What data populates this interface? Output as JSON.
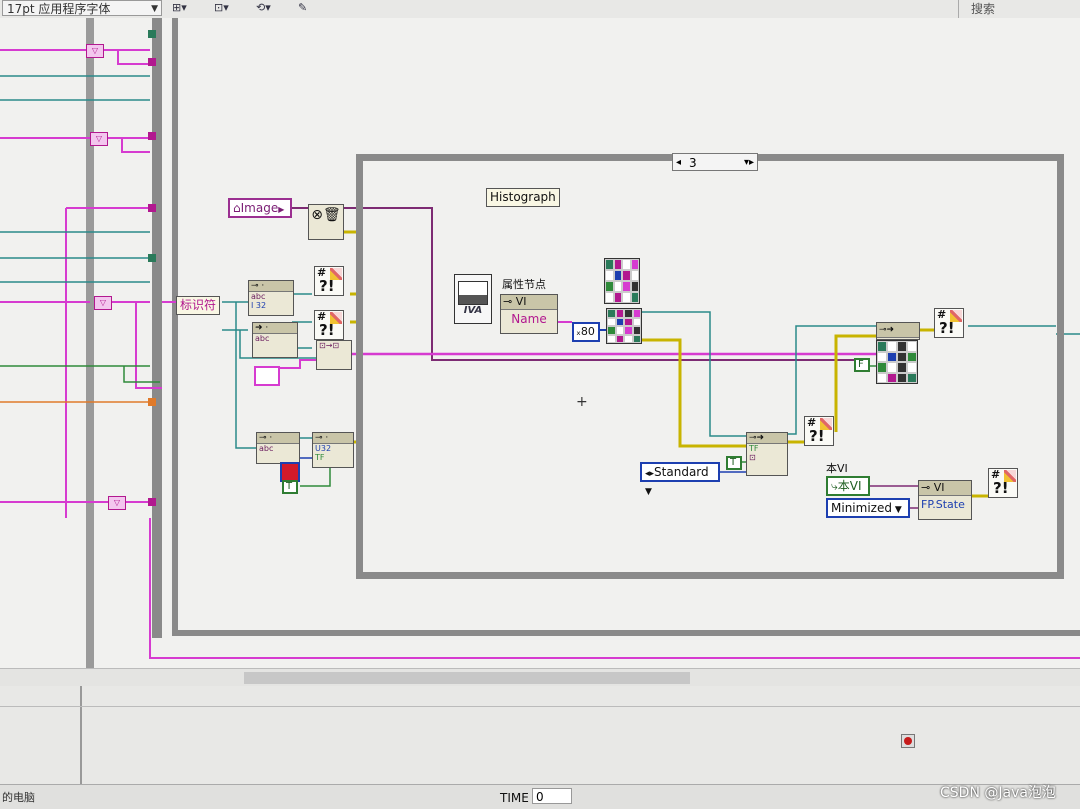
{
  "toolbar": {
    "font_selector": "17pt 应用程序字体",
    "align_icon": "align-objects-icon",
    "distribute_icon": "distribute-objects-icon",
    "reorder_icon": "reorder-icon",
    "cleanup_icon": "cleanup-diagram-icon",
    "search_label": "搜索"
  },
  "diagram": {
    "image_ref_label": "Image",
    "identifier_label": "标识符",
    "histograph_label": "Histograph",
    "property_node_label": "属性节点",
    "property_node_class": "VI",
    "property_node_property": "Name",
    "numeric_const": "80",
    "case_selector_value": "3",
    "standard_enum": "Standard",
    "this_vi_caption": "本VI",
    "this_vi_ref": "本VI",
    "minimized_enum": "Minimized",
    "fp_state_property": "FP.State",
    "fp_state_class": "VI",
    "true_const_1": "T",
    "true_const_2": "T",
    "f_const": "F",
    "node_abc": "abc",
    "node_i32": "I 32",
    "node_u32": "U32",
    "node_tf": "TF",
    "node_tf2": "TF"
  },
  "statusbar": {
    "left_text": "的电脑",
    "time_label": "TIME",
    "time_value": "0",
    "watermark": "CSDN @Java泡泡"
  },
  "colors": {
    "string_wire": "#d63bd0",
    "ref_wire": "#7d2b73",
    "error_wire": "#c8b400",
    "int_wire": "#2a5bd1",
    "bool_wire": "#2f8a3a",
    "cluster_wire": "#8a6a2a"
  }
}
